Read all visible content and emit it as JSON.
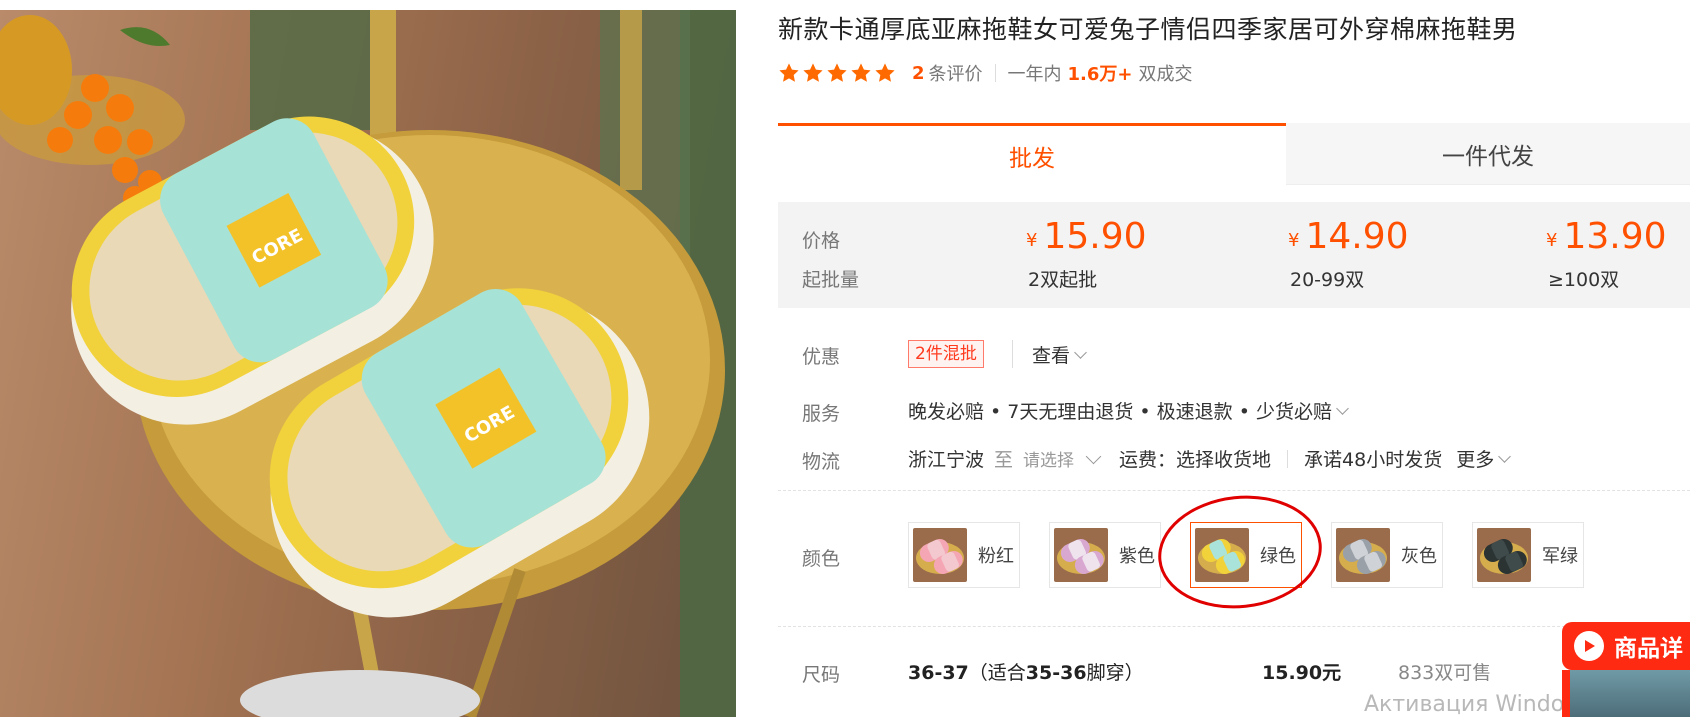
{
  "product": {
    "title": "新款卡通厚底亚麻拖鞋女可爱兔子情侣四季家居可外穿棉麻拖鞋男",
    "image_badge_text": "CORE"
  },
  "rating": {
    "stars": 5,
    "review_count": "2",
    "review_label": "条评价",
    "period_label": "一年内",
    "sales_value": "1.6万+",
    "sales_unit": "双成交"
  },
  "tabs": [
    {
      "label": "批发",
      "active": true
    },
    {
      "label": "一件代发",
      "active": false
    }
  ],
  "pricing": {
    "price_label": "价格",
    "moq_label": "起批量",
    "currency_symbol": "¥",
    "tiers": [
      {
        "price": "15.90",
        "quantity": "2双起批"
      },
      {
        "price": "14.90",
        "quantity": "20-99双"
      },
      {
        "price": "13.90",
        "quantity": "≥100双"
      }
    ]
  },
  "discount": {
    "label": "优惠",
    "badge": "2件混批",
    "link": "查看"
  },
  "service": {
    "label": "服务",
    "text": "晚发必赔 • 7天无理由退货 • 极速退款 • 少货必赔"
  },
  "logistics": {
    "label": "物流",
    "origin": "浙江宁波",
    "to": "至",
    "destination_placeholder": "请选择",
    "freight": "运费：选择收货地",
    "promise": "承诺48小时发货",
    "more": "更多"
  },
  "colors": {
    "label": "颜色",
    "options": [
      {
        "label": "粉红",
        "selected": false,
        "upper": "#f3c9cf",
        "trim": "#f4a6b4"
      },
      {
        "label": "紫色",
        "selected": false,
        "upper": "#efe3ee",
        "trim": "#d9a8d1"
      },
      {
        "label": "绿色",
        "selected": true,
        "upper": "#a9e3da",
        "trim": "#f2d23a"
      },
      {
        "label": "灰色",
        "selected": false,
        "upper": "#cfd3d8",
        "trim": "#9aa0a8"
      },
      {
        "label": "军绿",
        "selected": false,
        "upper": "#3f4a4a",
        "trim": "#2b3333"
      }
    ]
  },
  "size": {
    "label": "尺码",
    "name_bold": "36-37",
    "name_note_prefix": "（适合",
    "name_note_bold": "35-36",
    "name_note_suffix": "脚穿）",
    "price": "15.90元",
    "stock": "833双可售"
  },
  "floating_button": {
    "label": "商品详"
  },
  "watermark": "Активация Windows",
  "theme": {
    "accent": "#ff5000",
    "highlight_circle": "#e00000"
  }
}
